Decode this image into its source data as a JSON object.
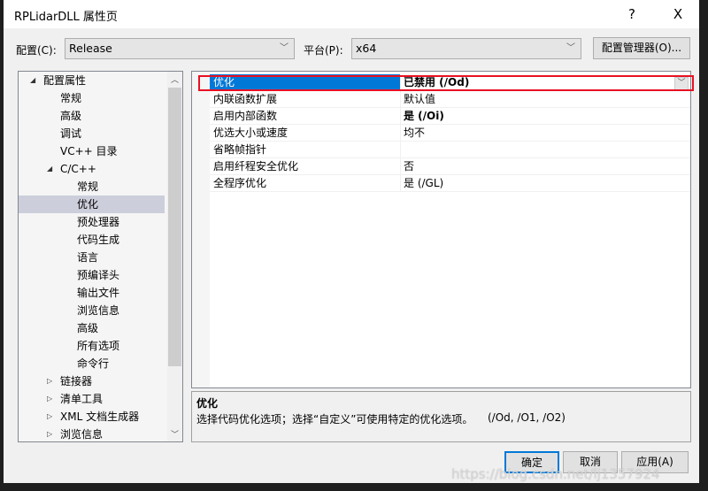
{
  "window": {
    "title": "RPLidarDLL 属性页",
    "help": "?",
    "close": "X"
  },
  "config": {
    "label": "配置(C):",
    "value": "Release",
    "platform_label": "平台(P):",
    "platform_value": "x64",
    "manager_button": "配置管理器(O)..."
  },
  "tree": [
    {
      "label": "配置属性",
      "level": 0,
      "expanded": true
    },
    {
      "label": "常规",
      "level": 1
    },
    {
      "label": "高级",
      "level": 1
    },
    {
      "label": "调试",
      "level": 1
    },
    {
      "label": "VC++ 目录",
      "level": 1
    },
    {
      "label": "C/C++",
      "level": 1,
      "expanded": true
    },
    {
      "label": "常规",
      "level": 2
    },
    {
      "label": "优化",
      "level": 2,
      "selected": true
    },
    {
      "label": "预处理器",
      "level": 2
    },
    {
      "label": "代码生成",
      "level": 2
    },
    {
      "label": "语言",
      "level": 2
    },
    {
      "label": "预编译头",
      "level": 2
    },
    {
      "label": "输出文件",
      "level": 2
    },
    {
      "label": "浏览信息",
      "level": 2
    },
    {
      "label": "高级",
      "level": 2
    },
    {
      "label": "所有选项",
      "level": 2
    },
    {
      "label": "命令行",
      "level": 2
    },
    {
      "label": "链接器",
      "level": 1,
      "collapsed": true
    },
    {
      "label": "清单工具",
      "level": 1,
      "collapsed": true
    },
    {
      "label": "XML 文档生成器",
      "level": 1,
      "collapsed": true
    },
    {
      "label": "浏览信息",
      "level": 1,
      "collapsed": true
    }
  ],
  "properties": [
    {
      "name": "优化",
      "value": "已禁用 (/Od)",
      "bold": true,
      "selected": true
    },
    {
      "name": "内联函数扩展",
      "value": "默认值"
    },
    {
      "name": "启用内部函数",
      "value": "是 (/Oi)",
      "bold": true
    },
    {
      "name": "优选大小或速度",
      "value": "均不"
    },
    {
      "name": "省略帧指针",
      "value": ""
    },
    {
      "name": "启用纤程安全优化",
      "value": "否"
    },
    {
      "name": "全程序优化",
      "value": "是 (/GL)"
    }
  ],
  "description": {
    "title": "优化",
    "text": "选择代码优化选项；选择“自定义”可使用特定的优化选项。",
    "switches": "(/Od, /O1, /O2)"
  },
  "buttons": {
    "ok": "确定",
    "cancel": "取消",
    "apply": "应用(A)"
  },
  "watermark": "https://blog.csdn.net/lj1357924"
}
